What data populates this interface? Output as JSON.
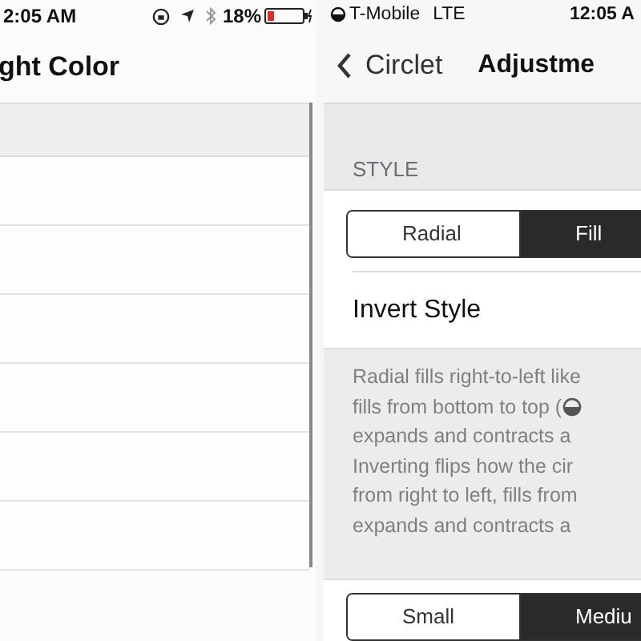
{
  "left_screen": {
    "status_bar": {
      "time": "2:05 AM",
      "battery_percent": "18%"
    },
    "nav_title": "ght Color",
    "rows": [
      {
        "kind": "blank"
      },
      {
        "kind": "blank"
      },
      {
        "kind": "blank"
      },
      {
        "kind": "blank"
      },
      {
        "kind": "blank"
      },
      {
        "kind": "blank"
      }
    ]
  },
  "right_screen": {
    "status_bar": {
      "carrier": "T-Mobile",
      "network": "LTE",
      "time": "12:05 A"
    },
    "nav": {
      "back": "Circlet",
      "title": "Adjustme"
    },
    "section_header": "STYLE",
    "style_segments": [
      {
        "label": "Radial",
        "selected": false
      },
      {
        "label": "Fill",
        "selected": true
      }
    ],
    "invert_row": {
      "label": "Invert Style"
    },
    "footer_lines": [
      {
        "text": "Radial fills right-to-left like"
      },
      {
        "text": "fills from bottom to top (",
        "icon": true
      },
      {
        "text": "expands and contracts a"
      },
      {
        "text": "Inverting flips how the cir"
      },
      {
        "text": "from right to left, fills from"
      },
      {
        "text": "expands and contracts a"
      }
    ],
    "size_segments": [
      {
        "label": "Small",
        "selected": false
      },
      {
        "label": "Mediu",
        "selected": true
      }
    ]
  }
}
